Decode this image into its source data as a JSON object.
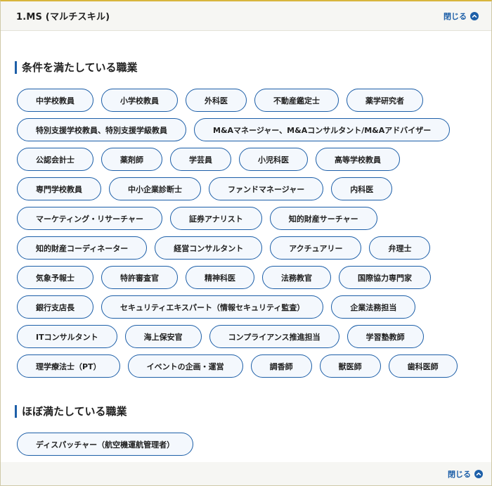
{
  "colors": {
    "accent": "#1d5fa8",
    "header_bg": "#f6f6f3",
    "top_border": "#d8b53d"
  },
  "header": {
    "title": "1.MS (マルチスキル)",
    "toggle_label": "閉じる",
    "toggle_icon": "chevron-up-icon"
  },
  "sections": [
    {
      "title": "条件を満たしている職業",
      "items": [
        "中学校教員",
        "小学校教員",
        "外科医",
        "不動産鑑定士",
        "薬学研究者",
        "特別支援学校教員、特別支援学級教員",
        "M&Aマネージャー、M&Aコンサルタント/M&Aアドバイザー",
        "公認会計士",
        "薬剤師",
        "学芸員",
        "小児科医",
        "高等学校教員",
        "専門学校教員",
        "中小企業診断士",
        "ファンドマネージャー",
        "内科医",
        "マーケティング・リサーチャー",
        "証券アナリスト",
        "知的財産サーチャー",
        "知的財産コーディネーター",
        "経営コンサルタント",
        "アクチュアリー",
        "弁理士",
        "気象予報士",
        "特許審査官",
        "精神科医",
        "法務教官",
        "国際協力専門家",
        "銀行支店長",
        "セキュリティエキスパート（情報セキュリティ監査）",
        "企業法務担当",
        "ITコンサルタント",
        "海上保安官",
        "コンプライアンス推進担当",
        "学習塾教師",
        "理学療法士（PT）",
        "イベントの企画・運営",
        "調香師",
        "獣医師",
        "歯科医師"
      ]
    },
    {
      "title": "ほぼ満たしている職業",
      "items": [
        "ディスパッチャー（航空機運航管理者）"
      ]
    }
  ],
  "footer": {
    "toggle_label": "閉じる",
    "toggle_icon": "chevron-up-icon"
  }
}
